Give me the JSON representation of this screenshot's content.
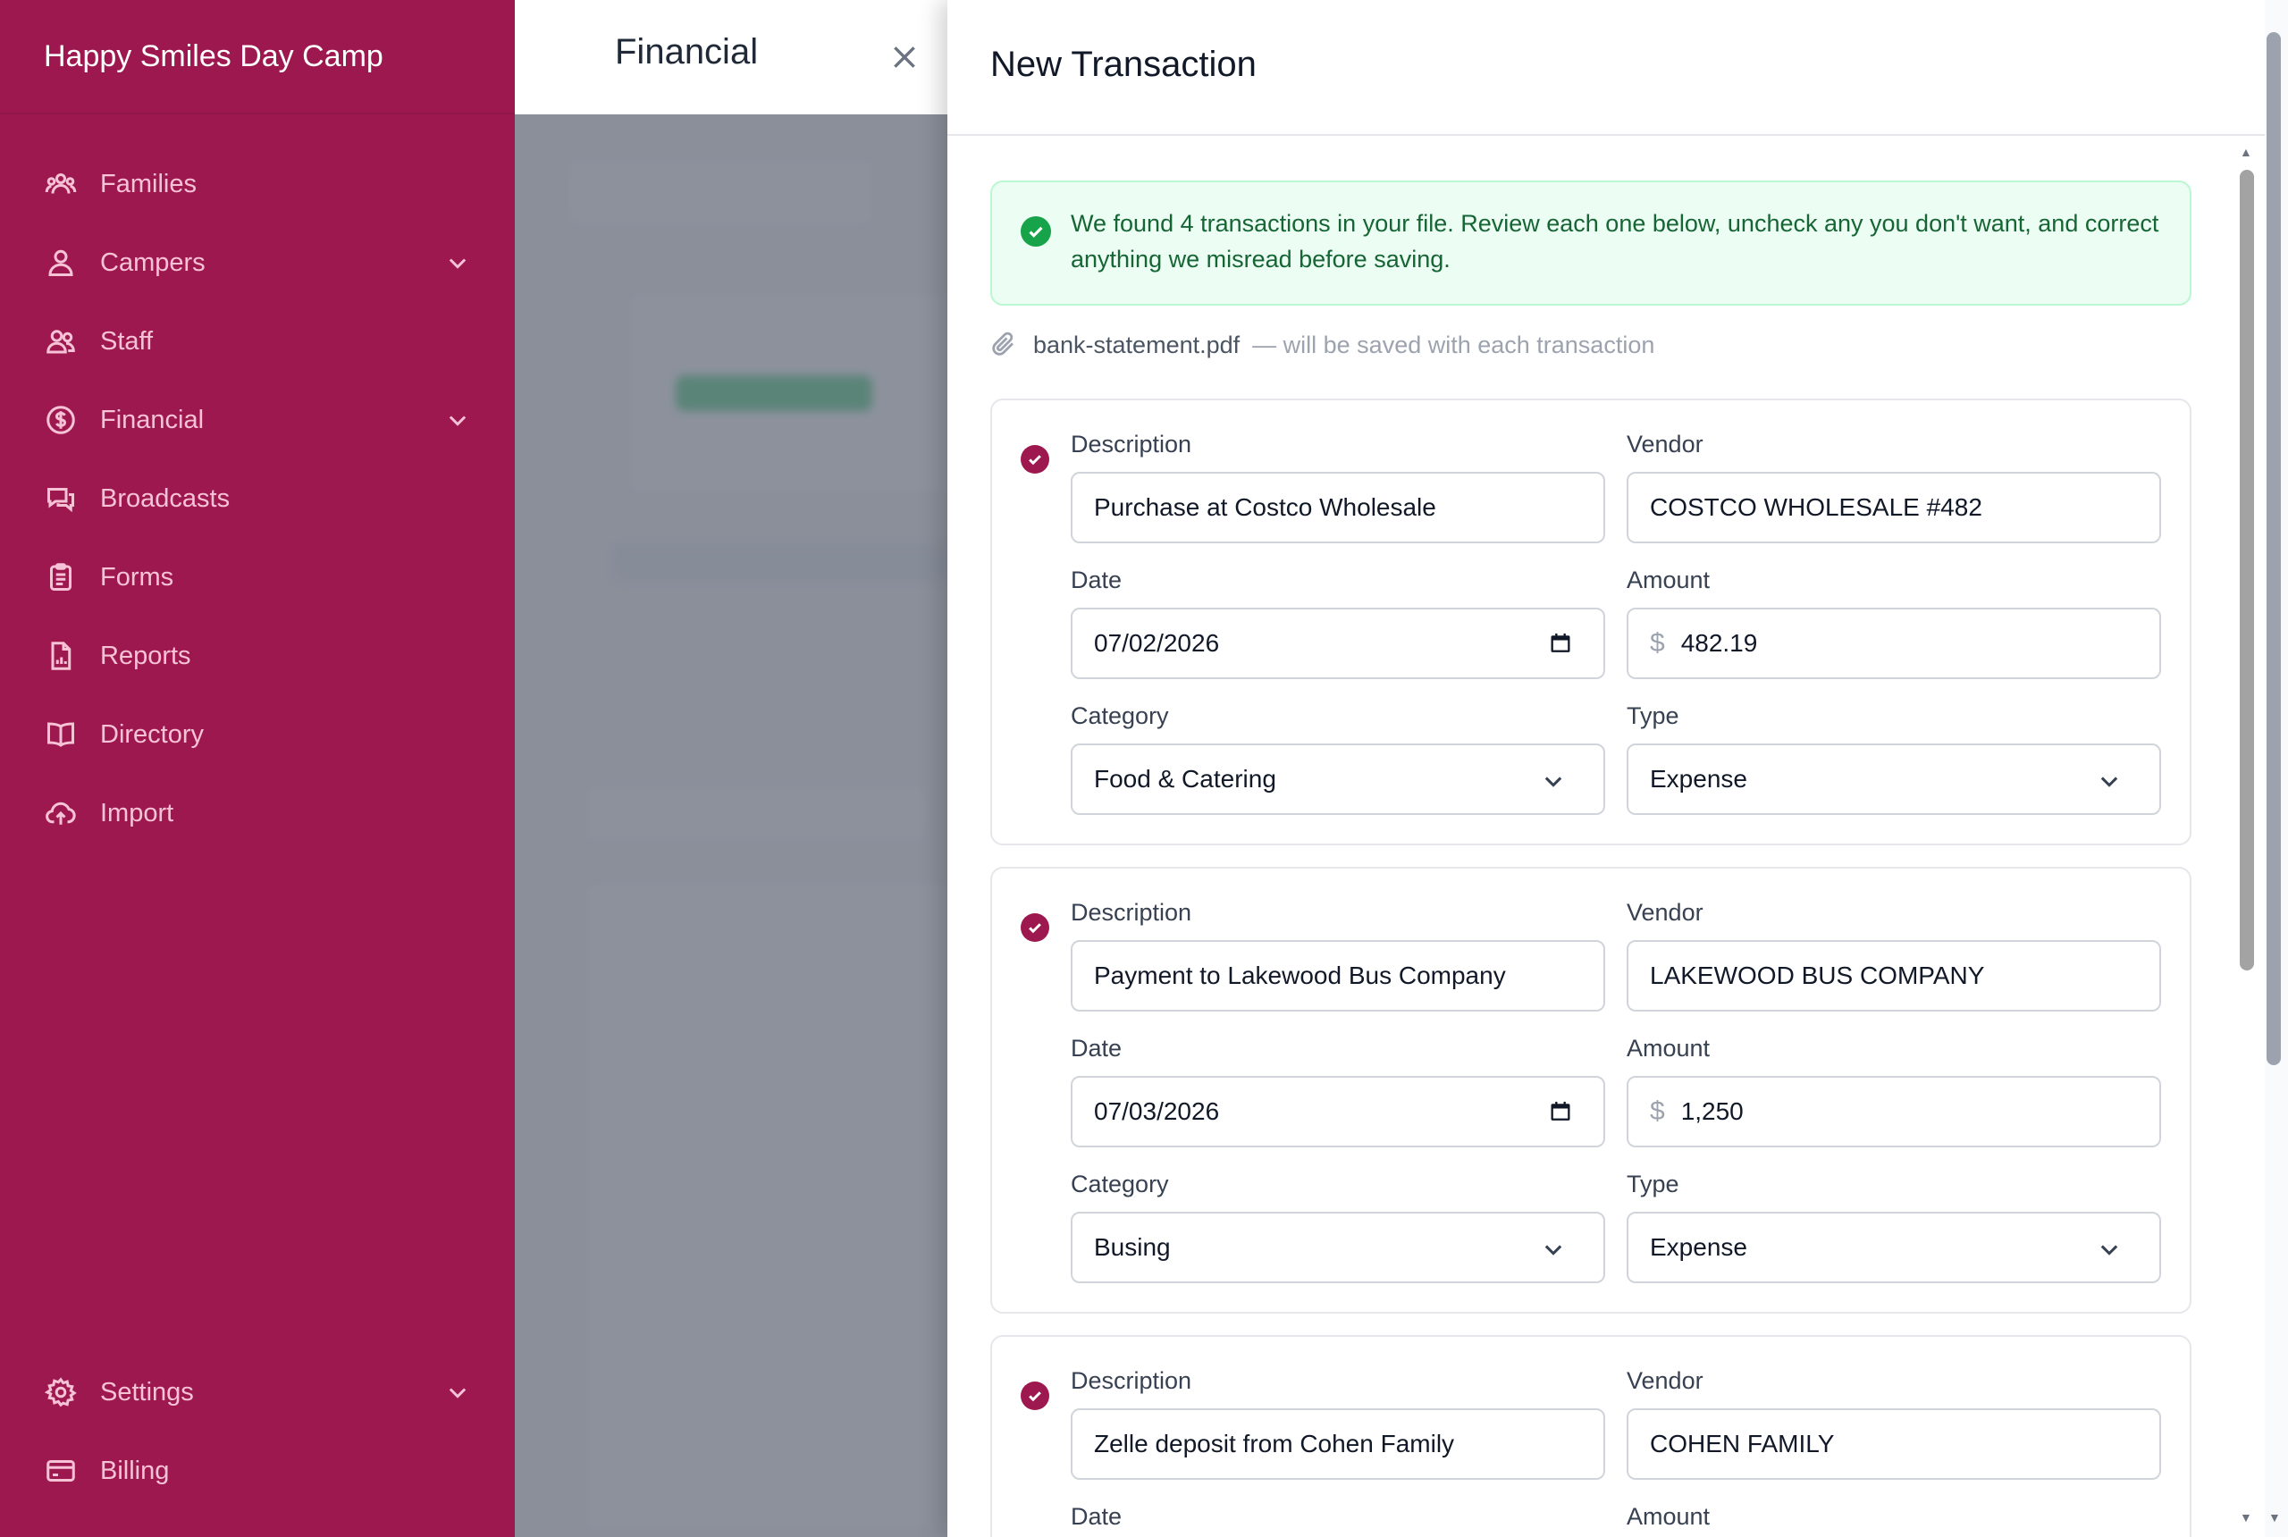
{
  "app": {
    "brand": "Happy Smiles Day Camp"
  },
  "sidebar": {
    "items": [
      {
        "label": "Families",
        "icon": "families-icon"
      },
      {
        "label": "Campers",
        "icon": "camper-icon",
        "expandable": true
      },
      {
        "label": "Staff",
        "icon": "staff-icon"
      },
      {
        "label": "Financial",
        "icon": "dollar-icon",
        "expandable": true
      },
      {
        "label": "Broadcasts",
        "icon": "chat-icon"
      },
      {
        "label": "Forms",
        "icon": "clipboard-icon"
      },
      {
        "label": "Reports",
        "icon": "report-icon"
      },
      {
        "label": "Directory",
        "icon": "book-icon"
      },
      {
        "label": "Import",
        "icon": "cloud-upload-icon"
      }
    ],
    "bottom": [
      {
        "label": "Settings",
        "icon": "gear-icon",
        "expandable": true
      },
      {
        "label": "Billing",
        "icon": "credit-card-icon"
      }
    ]
  },
  "page": {
    "title": "Financial"
  },
  "panel": {
    "title": "New Transaction",
    "alert": "We found 4 transactions in your file. Review each one below, uncheck any you don't want, and correct anything we misread before saving.",
    "file_name": "bank-statement.pdf",
    "file_note": "— will be saved with each transaction",
    "labels": {
      "description": "Description",
      "vendor": "Vendor",
      "date": "Date",
      "amount": "Amount",
      "category": "Category",
      "type": "Type",
      "currency": "$"
    },
    "transactions": [
      {
        "checked": true,
        "description": "Purchase at Costco Wholesale",
        "vendor": "COSTCO WHOLESALE #482",
        "date": "07/02/2026",
        "amount": "482.19",
        "category": "Food & Catering",
        "type": "Expense"
      },
      {
        "checked": true,
        "description": "Payment to Lakewood Bus Company",
        "vendor": "LAKEWOOD BUS COMPANY",
        "date": "07/03/2026",
        "amount": "1,250",
        "category": "Busing",
        "type": "Expense"
      },
      {
        "checked": true,
        "description": "Zelle deposit from Cohen Family",
        "vendor": "COHEN FAMILY"
      }
    ]
  },
  "colors": {
    "brand": "#9e1850",
    "success": "#16a34a"
  }
}
